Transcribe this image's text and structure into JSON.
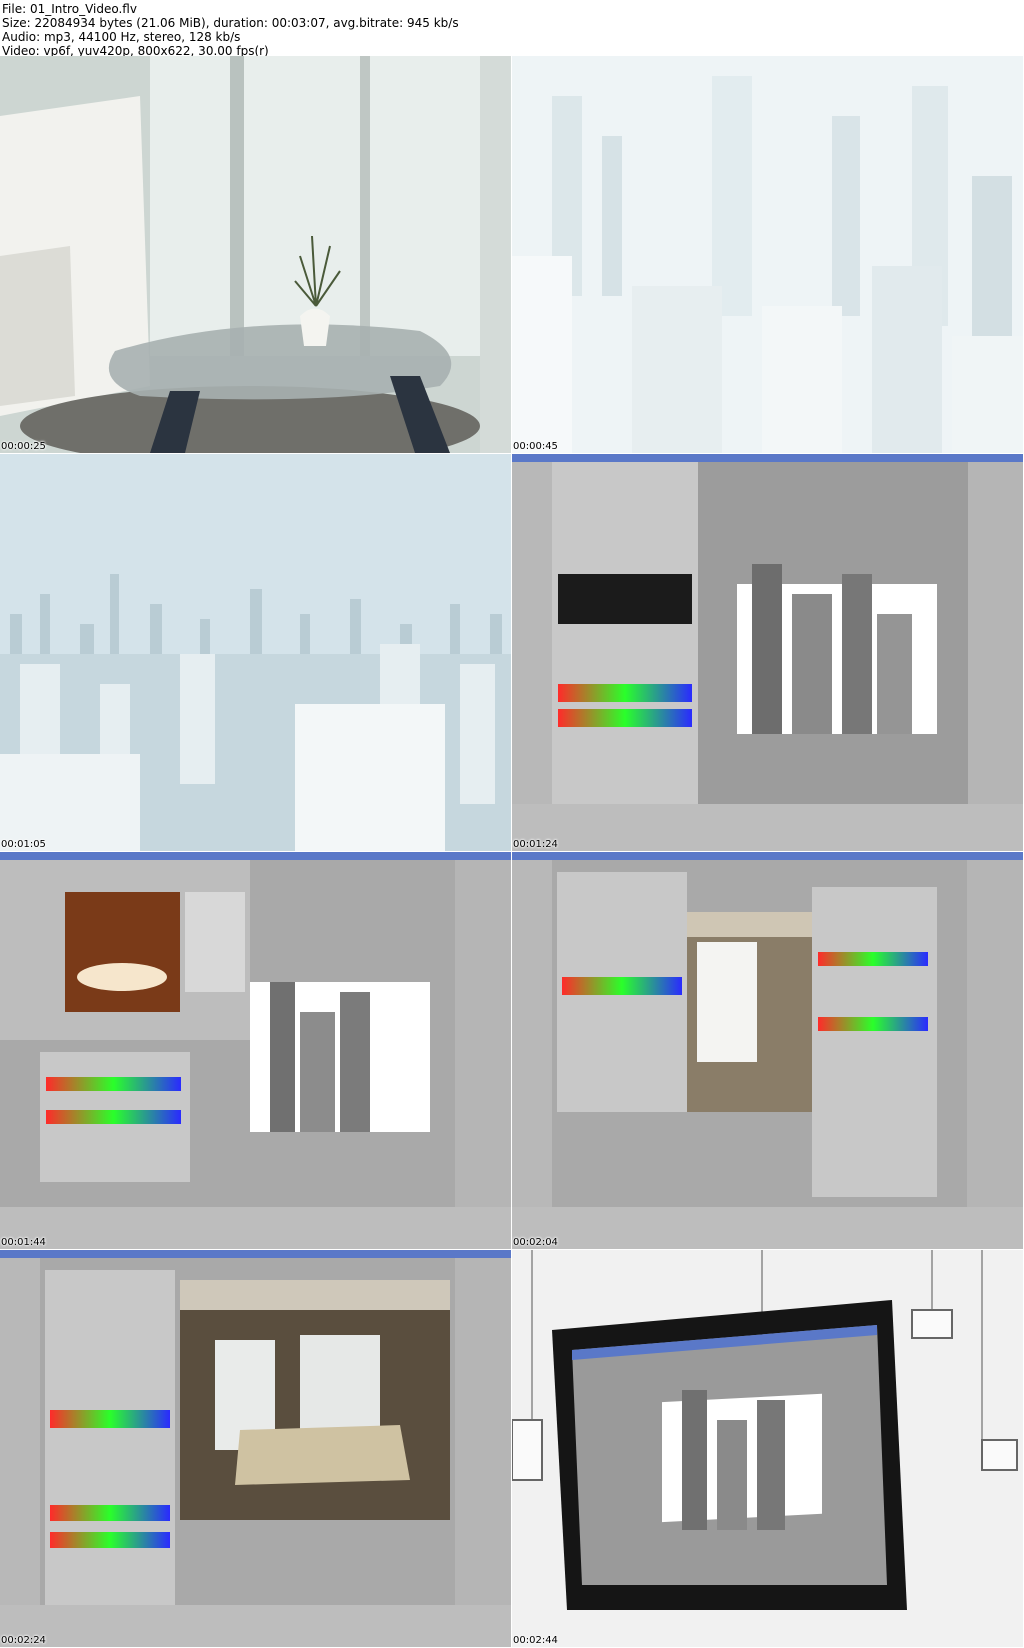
{
  "header": {
    "file": "File: 01_Intro_Video.flv",
    "size": "Size: 22084934 bytes (21.06 MiB), duration: 00:03:07, avg.bitrate: 945 kb/s",
    "audio": "Audio: mp3, 44100 Hz, stereo, 128 kb/s",
    "video": "Video: vp6f, yuv420p, 800x622, 30.00 fps(r)"
  },
  "frames": [
    {
      "timestamp": "00:00:25",
      "scene": "interior-table"
    },
    {
      "timestamp": "00:00:45",
      "scene": "white-city-close"
    },
    {
      "timestamp": "00:01:05",
      "scene": "white-city-wide"
    },
    {
      "timestamp": "00:01:24",
      "scene": "software-render-city"
    },
    {
      "timestamp": "00:01:44",
      "scene": "software-render-light"
    },
    {
      "timestamp": "00:02:04",
      "scene": "software-render-room"
    },
    {
      "timestamp": "00:02:24",
      "scene": "software-render-sofa"
    },
    {
      "timestamp": "00:02:44",
      "scene": "monitor-gallery"
    }
  ],
  "colors": {
    "ui_gray": "#a9a9a9",
    "ui_title": "#5a78c8",
    "sky": "#dfe9ee",
    "building": "#e9eef0",
    "table_top": "#9aa6a8",
    "wall": "#cfd8d5"
  }
}
